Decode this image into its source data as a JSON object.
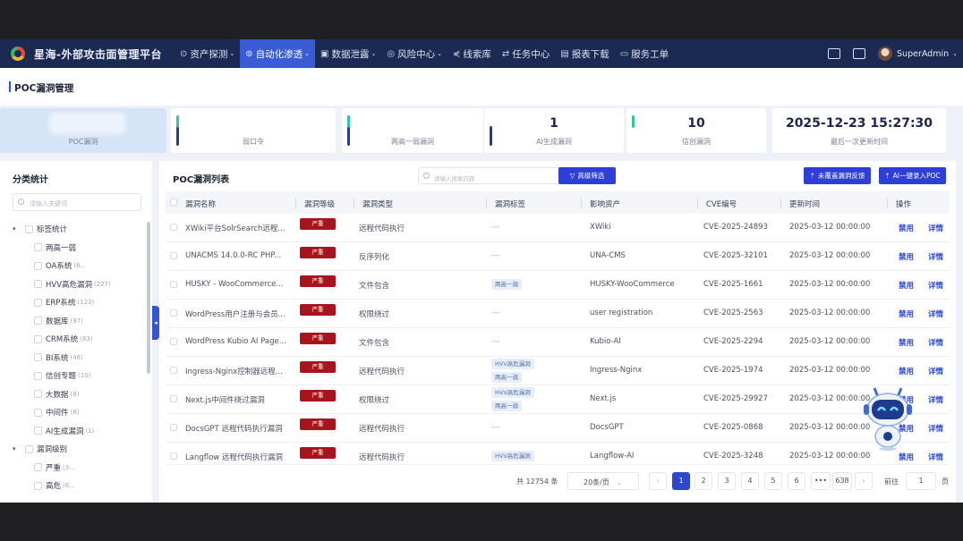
{
  "app": {
    "title": "星海-外部攻击面管理平台"
  },
  "nav": [
    {
      "label": "资产探测",
      "icon": "⊙",
      "dropdown": true
    },
    {
      "label": "自动化渗透",
      "icon": "⊚",
      "dropdown": true,
      "active": true
    },
    {
      "label": "数据泄露",
      "icon": "▣",
      "dropdown": true
    },
    {
      "label": "风险中心",
      "icon": "◎",
      "dropdown": true
    },
    {
      "label": "线索库",
      "icon": "⋞",
      "dropdown": false
    },
    {
      "label": "任务中心",
      "icon": "⇄",
      "dropdown": false
    },
    {
      "label": "报表下载",
      "icon": "▤",
      "dropdown": false
    },
    {
      "label": "服务工单",
      "icon": "▭",
      "dropdown": false
    }
  ],
  "user": {
    "name": "SuperAdmin"
  },
  "page": {
    "title": "POC漏洞管理"
  },
  "stats": [
    {
      "value": "",
      "label": "POC漏洞"
    },
    {
      "value": "",
      "label": "弱口令"
    },
    {
      "value": "",
      "label": "两高一弱漏洞"
    },
    {
      "value": "1",
      "label": "AI生成漏洞"
    },
    {
      "value": "10",
      "label": "信创漏洞"
    },
    {
      "value": "2025-12-23 15:27:30",
      "label": "最后一次更新时间"
    }
  ],
  "sidebar": {
    "title": "分类统计",
    "search_placeholder": "请输入关键词",
    "tree": [
      {
        "label": "标签统计",
        "level": 0,
        "expanded": true,
        "count": ""
      },
      {
        "label": "两高一弱",
        "level": 1,
        "count": ""
      },
      {
        "label": "OA系统",
        "level": 1,
        "count": "(6..."
      },
      {
        "label": "HVV高危漏洞",
        "level": 1,
        "count": "(227)"
      },
      {
        "label": "ERP系统",
        "level": 1,
        "count": "(123)"
      },
      {
        "label": "数据库",
        "level": 1,
        "count": "(97)"
      },
      {
        "label": "CRM系统",
        "level": 1,
        "count": "(83)"
      },
      {
        "label": "BI系统",
        "level": 1,
        "count": "(46)"
      },
      {
        "label": "信创专题",
        "level": 1,
        "count": "(10)"
      },
      {
        "label": "大数据",
        "level": 1,
        "count": "(8)"
      },
      {
        "label": "中间件",
        "level": 1,
        "count": "(6)"
      },
      {
        "label": "AI生成漏洞",
        "level": 1,
        "count": "(1)"
      },
      {
        "label": "漏洞级别",
        "level": 0,
        "expanded": true,
        "count": ""
      },
      {
        "label": "严重",
        "level": 1,
        "count": "(3..."
      },
      {
        "label": "高危",
        "level": 1,
        "count": "(6..."
      }
    ]
  },
  "list": {
    "title": "POC漏洞列表",
    "search_placeholder": "请输入搜索内容",
    "advanced_filter": "高级筛选",
    "btn_feedback": "未覆盖漏洞反馈",
    "btn_ai": "AI一键录入POC",
    "columns": [
      "漏洞名称",
      "漏洞等级",
      "漏洞类型",
      "漏洞标签",
      "影响资产",
      "CVE编号",
      "更新时间",
      "操作"
    ],
    "rows": [
      {
        "name": "XWiki平台SolrSearch远程...",
        "level": "严重",
        "type": "远程代码执行",
        "tags": [],
        "asset": "XWiki",
        "cve": "CVE-2025-24893",
        "time": "2025-03-12 00:00:00"
      },
      {
        "name": "UNACMS 14.0.0-RC PHP...",
        "level": "严重",
        "type": "反序列化",
        "tags": [],
        "asset": "UNA-CMS",
        "cve": "CVE-2025-32101",
        "time": "2025-03-12 00:00:00"
      },
      {
        "name": "HUSKY - WooCommerce...",
        "level": "严重",
        "type": "文件包含",
        "tags": [
          "两高一弱"
        ],
        "asset": "HUSKY-WooCommerce",
        "cve": "CVE-2025-1661",
        "time": "2025-03-12 00:00:00"
      },
      {
        "name": "WordPress用户注册与会员...",
        "level": "严重",
        "type": "权限绕过",
        "tags": [],
        "asset": "user registration",
        "cve": "CVE-2025-2563",
        "time": "2025-03-12 00:00:00"
      },
      {
        "name": "WordPress Kubio AI Page...",
        "level": "严重",
        "type": "文件包含",
        "tags": [],
        "asset": "Kubio-AI",
        "cve": "CVE-2025-2294",
        "time": "2025-03-12 00:00:00"
      },
      {
        "name": "Ingress-Nginx控制器远程...",
        "level": "严重",
        "type": "远程代码执行",
        "tags": [
          "HVV高危漏洞",
          "两高一弱"
        ],
        "asset": "Ingress-Nginx",
        "cve": "CVE-2025-1974",
        "time": "2025-03-12 00:00:00"
      },
      {
        "name": "Next.js中间件绕过漏洞",
        "level": "严重",
        "type": "权限绕过",
        "tags": [
          "HVV高危漏洞",
          "两高一弱"
        ],
        "asset": "Next.js",
        "cve": "CVE-2025-29927",
        "time": "2025-03-12 00:00:00"
      },
      {
        "name": "DocsGPT 远程代码执行漏洞",
        "level": "严重",
        "type": "远程代码执行",
        "tags": [],
        "asset": "DocsGPT",
        "cve": "CVE-2025-0868",
        "time": "2025-03-12 00:00:00"
      },
      {
        "name": "Langflow 远程代码执行漏洞",
        "level": "严重",
        "type": "远程代码执行",
        "tags": [
          "HVV高危漏洞"
        ],
        "asset": "Langflow-AI",
        "cve": "CVE-2025-3248",
        "time": "2025-03-12 00:00:00"
      }
    ],
    "empty_tag": "---",
    "action_disable": "禁用",
    "action_detail": "详情"
  },
  "pagination": {
    "total": "共 12754 条",
    "page_size": "20条/页",
    "pages": [
      "1",
      "2",
      "3",
      "4",
      "5",
      "6",
      "•••",
      "638"
    ],
    "current": "1",
    "goto_label": "前往",
    "goto_value": "1",
    "page_suffix": "页"
  },
  "colors": {
    "nav_bg": "#1b2a52",
    "accent": "#2d3fd4",
    "severity_critical": "#a8141c"
  }
}
